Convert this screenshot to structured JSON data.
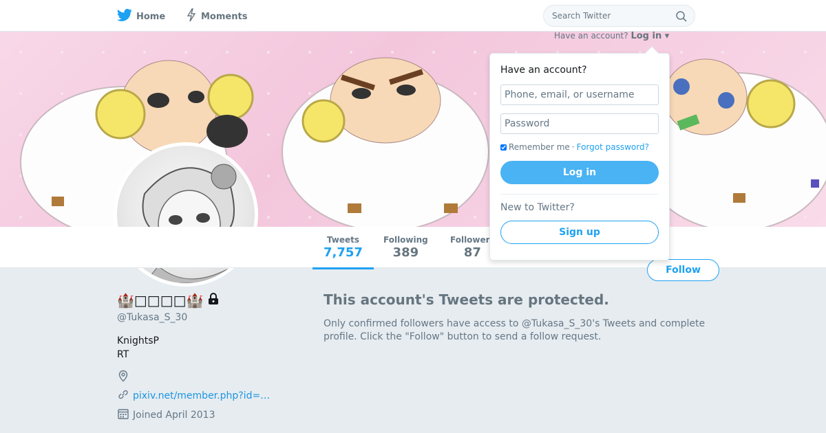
{
  "nav": {
    "home_label": "Home",
    "moments_label": "Moments",
    "search_placeholder": "Search Twitter"
  },
  "login_hint": {
    "text": "Have an account?",
    "link": "Log in"
  },
  "dropdown": {
    "title": "Have an account?",
    "username_placeholder": "Phone, email, or username",
    "password_placeholder": "Password",
    "remember_label": "Remember me",
    "separator": "·",
    "forgot_label": "Forgot password?",
    "login_button": "Log in",
    "new_label": "New to Twitter?",
    "signup_button": "Sign up"
  },
  "stats": [
    {
      "label": "Tweets",
      "value": "7,757",
      "active": true
    },
    {
      "label": "Following",
      "value": "389",
      "active": false
    },
    {
      "label": "Followers",
      "value": "87",
      "active": false
    }
  ],
  "follow_button": "Follow",
  "profile": {
    "name": "🏰□□□□🏰",
    "handle": "@Tukasa_S_30",
    "bio_line1": "KnightsP",
    "bio_line2": "RT",
    "location": "",
    "url": "pixiv.net/member.php?id=…",
    "joined": "Joined April 2013"
  },
  "protected": {
    "title": "This account's Tweets are protected.",
    "body": "Only confirmed followers have access to @Tukasa_S_30's Tweets and complete profile. Click the \"Follow\" button to send a follow request."
  },
  "colors": {
    "accent": "#1da1f2",
    "login_button_bg": "#4ab3f4",
    "page_bg": "#e6ecf0",
    "banner_pink": "#f3c6dc"
  },
  "icons": {
    "home": "bird-icon",
    "moments": "lightning-icon",
    "search": "search-icon",
    "lock": "lock-icon",
    "location": "location-pin-icon",
    "link": "link-icon",
    "calendar": "calendar-icon"
  }
}
